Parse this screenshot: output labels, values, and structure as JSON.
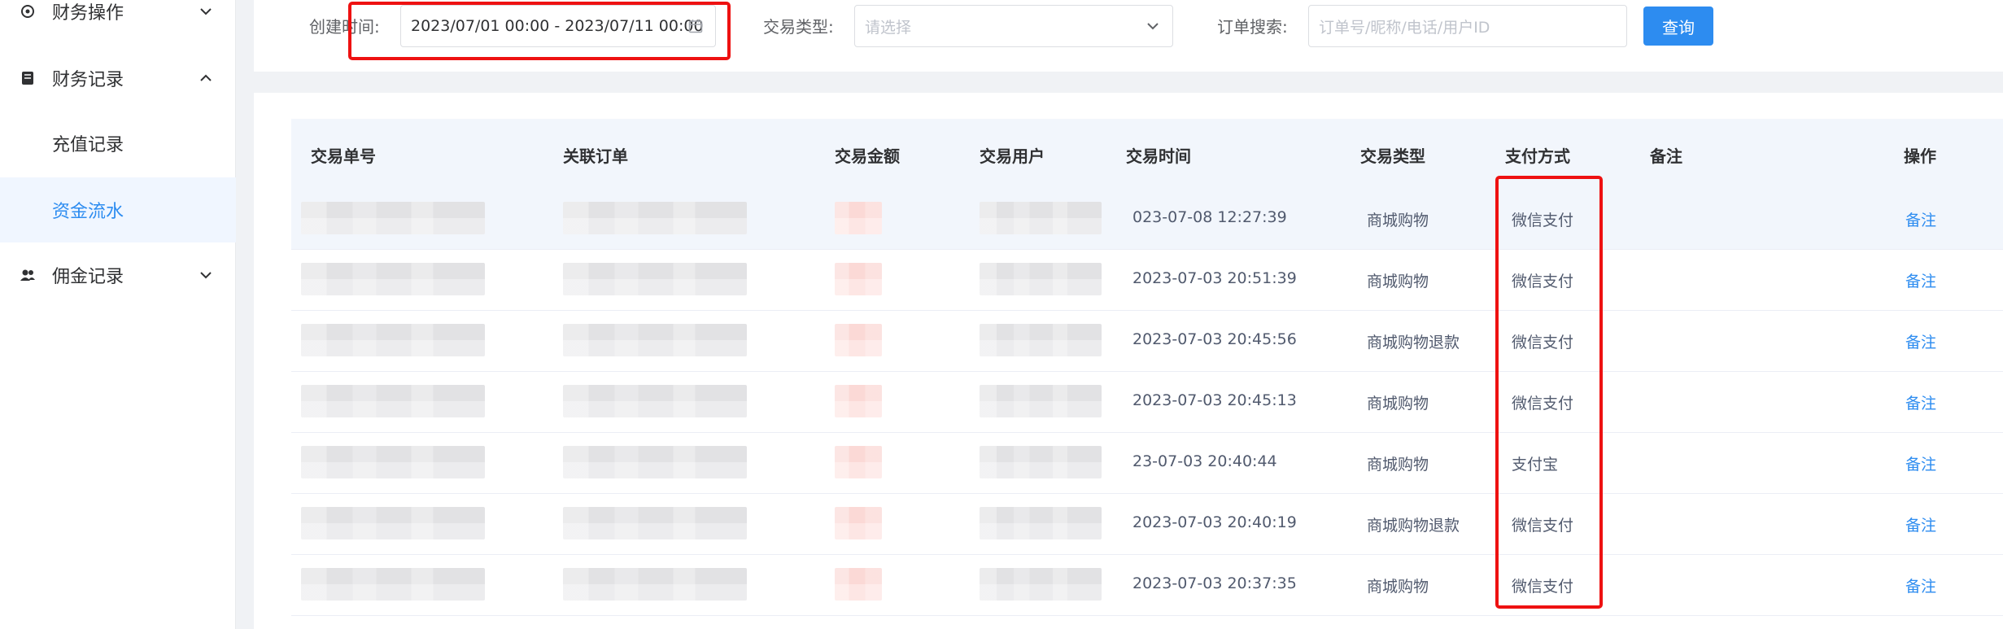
{
  "sidebar": {
    "items": [
      {
        "label": "财务操作",
        "icon": "finance-ops-icon",
        "expanded": false
      },
      {
        "label": "财务记录",
        "icon": "book-icon",
        "expanded": true,
        "children": [
          {
            "label": "充值记录",
            "active": false
          },
          {
            "label": "资金流水",
            "active": true
          }
        ]
      },
      {
        "label": "佣金记录",
        "icon": "users-icon",
        "expanded": false
      }
    ]
  },
  "filters": {
    "created_time_label": "创建时间:",
    "created_time_value": "2023/07/01 00:00 - 2023/07/11 00:00",
    "type_label": "交易类型:",
    "type_placeholder": "请选择",
    "search_label": "订单搜索:",
    "search_placeholder": "订单号/昵称/电话/用户ID",
    "query_button": "查询"
  },
  "table": {
    "columns": [
      "交易单号",
      "关联订单",
      "交易金额",
      "交易用户",
      "交易时间",
      "交易类型",
      "支付方式",
      "备注",
      "操作"
    ],
    "rows": [
      {
        "time": "2023-07-08 12:27:39",
        "time_display": "023-07-08 12:27:39",
        "type": "商城购物",
        "payment": "微信支付",
        "remark": "",
        "action": "备注"
      },
      {
        "time": "2023-07-03 20:51:39",
        "time_display": "2023-07-03 20:51:39",
        "type": "商城购物",
        "payment": "微信支付",
        "remark": "",
        "action": "备注"
      },
      {
        "time": "2023-07-03 20:45:56",
        "time_display": "2023-07-03 20:45:56",
        "type": "商城购物退款",
        "payment": "微信支付",
        "remark": "",
        "action": "备注"
      },
      {
        "time": "2023-07-03 20:45:13",
        "time_display": "2023-07-03 20:45:13",
        "type": "商城购物",
        "payment": "微信支付",
        "remark": "",
        "action": "备注"
      },
      {
        "time": "2023-07-03 20:40:44",
        "time_display": "23-07-03 20:40:44",
        "type": "商城购物",
        "payment": "支付宝",
        "remark": "",
        "action": "备注"
      },
      {
        "time": "2023-07-03 20:40:19",
        "time_display": "2023-07-03 20:40:19",
        "type": "商城购物退款",
        "payment": "微信支付",
        "remark": "",
        "action": "备注"
      },
      {
        "time": "2023-07-03 20:37:35",
        "time_display": "2023-07-03 20:37:35",
        "type": "商城购物",
        "payment": "微信支付",
        "remark": "",
        "action": "备注"
      }
    ]
  },
  "colors": {
    "accent": "#2d8cf0",
    "highlight": "#ee1111"
  }
}
